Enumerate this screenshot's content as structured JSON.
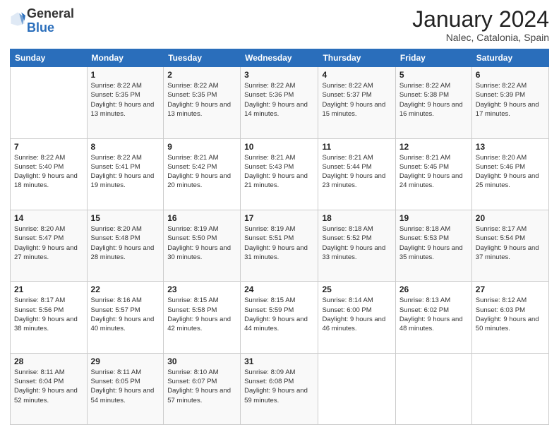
{
  "header": {
    "logo": {
      "general": "General",
      "blue": "Blue"
    },
    "title": "January 2024",
    "location": "Nalec, Catalonia, Spain"
  },
  "calendar": {
    "days_of_week": [
      "Sunday",
      "Monday",
      "Tuesday",
      "Wednesday",
      "Thursday",
      "Friday",
      "Saturday"
    ],
    "weeks": [
      [
        {
          "day": "",
          "sunrise": "",
          "sunset": "",
          "daylight": ""
        },
        {
          "day": "1",
          "sunrise": "Sunrise: 8:22 AM",
          "sunset": "Sunset: 5:35 PM",
          "daylight": "Daylight: 9 hours and 13 minutes."
        },
        {
          "day": "2",
          "sunrise": "Sunrise: 8:22 AM",
          "sunset": "Sunset: 5:35 PM",
          "daylight": "Daylight: 9 hours and 13 minutes."
        },
        {
          "day": "3",
          "sunrise": "Sunrise: 8:22 AM",
          "sunset": "Sunset: 5:36 PM",
          "daylight": "Daylight: 9 hours and 14 minutes."
        },
        {
          "day": "4",
          "sunrise": "Sunrise: 8:22 AM",
          "sunset": "Sunset: 5:37 PM",
          "daylight": "Daylight: 9 hours and 15 minutes."
        },
        {
          "day": "5",
          "sunrise": "Sunrise: 8:22 AM",
          "sunset": "Sunset: 5:38 PM",
          "daylight": "Daylight: 9 hours and 16 minutes."
        },
        {
          "day": "6",
          "sunrise": "Sunrise: 8:22 AM",
          "sunset": "Sunset: 5:39 PM",
          "daylight": "Daylight: 9 hours and 17 minutes."
        }
      ],
      [
        {
          "day": "7",
          "sunrise": "Sunrise: 8:22 AM",
          "sunset": "Sunset: 5:40 PM",
          "daylight": "Daylight: 9 hours and 18 minutes."
        },
        {
          "day": "8",
          "sunrise": "Sunrise: 8:22 AM",
          "sunset": "Sunset: 5:41 PM",
          "daylight": "Daylight: 9 hours and 19 minutes."
        },
        {
          "day": "9",
          "sunrise": "Sunrise: 8:21 AM",
          "sunset": "Sunset: 5:42 PM",
          "daylight": "Daylight: 9 hours and 20 minutes."
        },
        {
          "day": "10",
          "sunrise": "Sunrise: 8:21 AM",
          "sunset": "Sunset: 5:43 PM",
          "daylight": "Daylight: 9 hours and 21 minutes."
        },
        {
          "day": "11",
          "sunrise": "Sunrise: 8:21 AM",
          "sunset": "Sunset: 5:44 PM",
          "daylight": "Daylight: 9 hours and 23 minutes."
        },
        {
          "day": "12",
          "sunrise": "Sunrise: 8:21 AM",
          "sunset": "Sunset: 5:45 PM",
          "daylight": "Daylight: 9 hours and 24 minutes."
        },
        {
          "day": "13",
          "sunrise": "Sunrise: 8:20 AM",
          "sunset": "Sunset: 5:46 PM",
          "daylight": "Daylight: 9 hours and 25 minutes."
        }
      ],
      [
        {
          "day": "14",
          "sunrise": "Sunrise: 8:20 AM",
          "sunset": "Sunset: 5:47 PM",
          "daylight": "Daylight: 9 hours and 27 minutes."
        },
        {
          "day": "15",
          "sunrise": "Sunrise: 8:20 AM",
          "sunset": "Sunset: 5:48 PM",
          "daylight": "Daylight: 9 hours and 28 minutes."
        },
        {
          "day": "16",
          "sunrise": "Sunrise: 8:19 AM",
          "sunset": "Sunset: 5:50 PM",
          "daylight": "Daylight: 9 hours and 30 minutes."
        },
        {
          "day": "17",
          "sunrise": "Sunrise: 8:19 AM",
          "sunset": "Sunset: 5:51 PM",
          "daylight": "Daylight: 9 hours and 31 minutes."
        },
        {
          "day": "18",
          "sunrise": "Sunrise: 8:18 AM",
          "sunset": "Sunset: 5:52 PM",
          "daylight": "Daylight: 9 hours and 33 minutes."
        },
        {
          "day": "19",
          "sunrise": "Sunrise: 8:18 AM",
          "sunset": "Sunset: 5:53 PM",
          "daylight": "Daylight: 9 hours and 35 minutes."
        },
        {
          "day": "20",
          "sunrise": "Sunrise: 8:17 AM",
          "sunset": "Sunset: 5:54 PM",
          "daylight": "Daylight: 9 hours and 37 minutes."
        }
      ],
      [
        {
          "day": "21",
          "sunrise": "Sunrise: 8:17 AM",
          "sunset": "Sunset: 5:56 PM",
          "daylight": "Daylight: 9 hours and 38 minutes."
        },
        {
          "day": "22",
          "sunrise": "Sunrise: 8:16 AM",
          "sunset": "Sunset: 5:57 PM",
          "daylight": "Daylight: 9 hours and 40 minutes."
        },
        {
          "day": "23",
          "sunrise": "Sunrise: 8:15 AM",
          "sunset": "Sunset: 5:58 PM",
          "daylight": "Daylight: 9 hours and 42 minutes."
        },
        {
          "day": "24",
          "sunrise": "Sunrise: 8:15 AM",
          "sunset": "Sunset: 5:59 PM",
          "daylight": "Daylight: 9 hours and 44 minutes."
        },
        {
          "day": "25",
          "sunrise": "Sunrise: 8:14 AM",
          "sunset": "Sunset: 6:00 PM",
          "daylight": "Daylight: 9 hours and 46 minutes."
        },
        {
          "day": "26",
          "sunrise": "Sunrise: 8:13 AM",
          "sunset": "Sunset: 6:02 PM",
          "daylight": "Daylight: 9 hours and 48 minutes."
        },
        {
          "day": "27",
          "sunrise": "Sunrise: 8:12 AM",
          "sunset": "Sunset: 6:03 PM",
          "daylight": "Daylight: 9 hours and 50 minutes."
        }
      ],
      [
        {
          "day": "28",
          "sunrise": "Sunrise: 8:11 AM",
          "sunset": "Sunset: 6:04 PM",
          "daylight": "Daylight: 9 hours and 52 minutes."
        },
        {
          "day": "29",
          "sunrise": "Sunrise: 8:11 AM",
          "sunset": "Sunset: 6:05 PM",
          "daylight": "Daylight: 9 hours and 54 minutes."
        },
        {
          "day": "30",
          "sunrise": "Sunrise: 8:10 AM",
          "sunset": "Sunset: 6:07 PM",
          "daylight": "Daylight: 9 hours and 57 minutes."
        },
        {
          "day": "31",
          "sunrise": "Sunrise: 8:09 AM",
          "sunset": "Sunset: 6:08 PM",
          "daylight": "Daylight: 9 hours and 59 minutes."
        },
        {
          "day": "",
          "sunrise": "",
          "sunset": "",
          "daylight": ""
        },
        {
          "day": "",
          "sunrise": "",
          "sunset": "",
          "daylight": ""
        },
        {
          "day": "",
          "sunrise": "",
          "sunset": "",
          "daylight": ""
        }
      ]
    ]
  }
}
